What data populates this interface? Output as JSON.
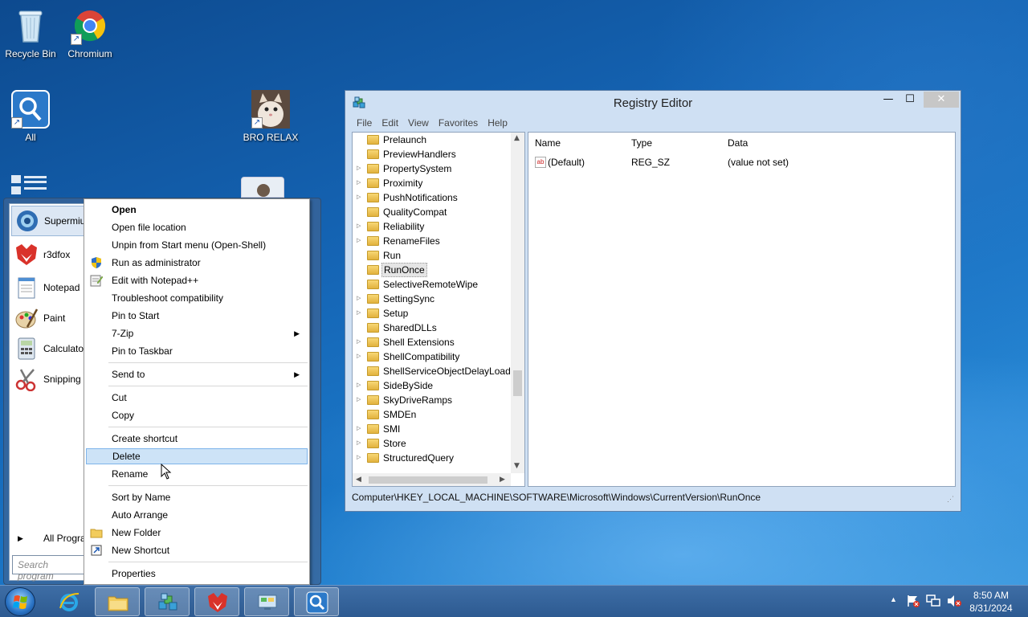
{
  "desktop": {
    "icons": [
      {
        "label": "Recycle Bin",
        "icon": "recycle-bin-icon"
      },
      {
        "label": "Chromium",
        "icon": "chromium-icon"
      },
      {
        "label": "All",
        "icon": "search-icon"
      },
      {
        "label": "BRO RELAX",
        "icon": "cat-photo-icon"
      }
    ]
  },
  "start_menu": {
    "items": [
      {
        "label": "Supermium",
        "icon": "supermium-icon"
      },
      {
        "label": "r3dfox",
        "icon": "r3dfox-icon"
      },
      {
        "label": "Notepad",
        "icon": "notepad-icon"
      },
      {
        "label": "Paint",
        "icon": "paint-icon"
      },
      {
        "label": "Calculator",
        "icon": "calculator-icon"
      },
      {
        "label": "Snipping T",
        "icon": "snipping-tool-icon"
      }
    ],
    "all_programs": "All Progra",
    "search_placeholder": "Search program"
  },
  "context_menu": {
    "group1": [
      "Open",
      "Open file location",
      "Unpin from Start menu (Open-Shell)",
      "Run as administrator",
      "Edit with Notepad++",
      "Troubleshoot compatibility",
      "Pin to Start",
      "7-Zip",
      "Pin to Taskbar"
    ],
    "group2": [
      "Send to"
    ],
    "group3": [
      "Cut",
      "Copy"
    ],
    "group4": [
      "Create shortcut",
      "Delete",
      "Rename"
    ],
    "group5": [
      "Sort by Name",
      "Auto Arrange",
      "New Folder",
      "New Shortcut"
    ],
    "group6": [
      "Properties"
    ]
  },
  "registry_editor": {
    "title": "Registry Editor",
    "menu": [
      "File",
      "Edit",
      "View",
      "Favorites",
      "Help"
    ],
    "tree": [
      {
        "label": "Prelaunch",
        "expandable": false
      },
      {
        "label": "PreviewHandlers",
        "expandable": false
      },
      {
        "label": "PropertySystem",
        "expandable": true
      },
      {
        "label": "Proximity",
        "expandable": true
      },
      {
        "label": "PushNotifications",
        "expandable": true
      },
      {
        "label": "QualityCompat",
        "expandable": false
      },
      {
        "label": "Reliability",
        "expandable": true
      },
      {
        "label": "RenameFiles",
        "expandable": true
      },
      {
        "label": "Run",
        "expandable": false
      },
      {
        "label": "RunOnce",
        "expandable": false,
        "selected": true
      },
      {
        "label": "SelectiveRemoteWipe",
        "expandable": false
      },
      {
        "label": "SettingSync",
        "expandable": true
      },
      {
        "label": "Setup",
        "expandable": true
      },
      {
        "label": "SharedDLLs",
        "expandable": false
      },
      {
        "label": "Shell Extensions",
        "expandable": true
      },
      {
        "label": "ShellCompatibility",
        "expandable": true
      },
      {
        "label": "ShellServiceObjectDelayLoad",
        "expandable": false
      },
      {
        "label": "SideBySide",
        "expandable": true
      },
      {
        "label": "SkyDriveRamps",
        "expandable": true
      },
      {
        "label": "SMDEn",
        "expandable": false
      },
      {
        "label": "SMI",
        "expandable": true
      },
      {
        "label": "Store",
        "expandable": true
      },
      {
        "label": "StructuredQuery",
        "expandable": true
      }
    ],
    "columns": {
      "name": "Name",
      "type": "Type",
      "data": "Data"
    },
    "values": [
      {
        "name": "(Default)",
        "type": "REG_SZ",
        "data": "(value not set)"
      }
    ],
    "status_path": "Computer\\HKEY_LOCAL_MACHINE\\SOFTWARE\\Microsoft\\Windows\\CurrentVersion\\RunOnce"
  },
  "taskbar": {
    "apps": [
      "windows-explorer-icon",
      "registry-editor-icon",
      "r3dfox-icon",
      "control-panel-icon",
      "search-icon"
    ],
    "time": "8:50 AM",
    "date": "8/31/2024"
  }
}
